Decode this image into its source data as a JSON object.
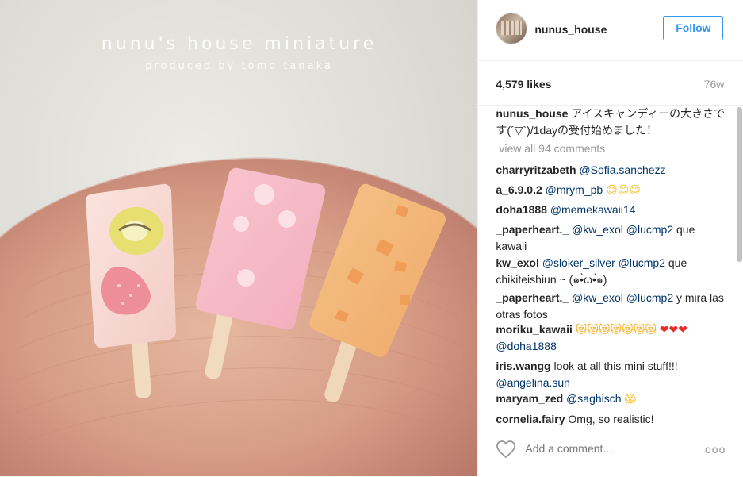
{
  "photo": {
    "watermark_title": "nunu's house miniature",
    "watermark_sub": "produced by tomo tanaka"
  },
  "post": {
    "username": "nunus_house",
    "follow_label": "Follow",
    "likes": "4,579 likes",
    "age": "76w",
    "caption_user": "nunus_house",
    "caption_text": "アイスキャンディーの大きさです(´▽`)/1dayの受付始めました！",
    "view_all": "view all 94 comments",
    "add_comment_placeholder": "Add a comment...",
    "more_label": "ooo"
  },
  "comments": [
    {
      "user": "charryritzabeth",
      "parts": [
        {
          "t": "mention",
          "v": "@Sofia.sanchezz"
        }
      ]
    },
    {
      "user": "a_6.9.0.2",
      "parts": [
        {
          "t": "mention",
          "v": "@mrym_pb"
        },
        {
          "t": "text",
          "v": " "
        },
        {
          "t": "emoji",
          "v": "😊😊😊",
          "cls": "yface"
        }
      ]
    },
    {
      "user": "doha1888",
      "parts": [
        {
          "t": "mention",
          "v": "@memekawaii14"
        }
      ]
    },
    {
      "user": "_paperheart._",
      "parts": [
        {
          "t": "mention",
          "v": "@kw_exol"
        },
        {
          "t": "text",
          "v": " "
        },
        {
          "t": "mention",
          "v": "@lucmp2"
        },
        {
          "t": "text",
          "v": " que kawaii"
        }
      ]
    },
    {
      "user": "kw_exol",
      "parts": [
        {
          "t": "mention",
          "v": "@sloker_silver"
        },
        {
          "t": "text",
          "v": " "
        },
        {
          "t": "mention",
          "v": "@lucmp2"
        },
        {
          "t": "text",
          "v": " que chikiteishiun ~ (๑•̀ω•́๑)"
        }
      ]
    },
    {
      "user": "_paperheart._",
      "parts": [
        {
          "t": "mention",
          "v": "@kw_exol"
        },
        {
          "t": "text",
          "v": " "
        },
        {
          "t": "mention",
          "v": "@lucmp2"
        },
        {
          "t": "text",
          "v": " y mira las otras fotos"
        }
      ]
    },
    {
      "user": "moriku_kawaii",
      "parts": [
        {
          "t": "emoji",
          "v": "😻😻😻😻😻😻😻",
          "cls": "cat"
        },
        {
          "t": "text",
          "v": " "
        },
        {
          "t": "emoji",
          "v": "❤❤❤",
          "cls": "heart"
        },
        {
          "t": "text",
          "v": " "
        },
        {
          "t": "mention",
          "v": "@doha1888"
        }
      ]
    },
    {
      "user": "iris.wangg",
      "parts": [
        {
          "t": "text",
          "v": "look at all this mini stuff!!! "
        },
        {
          "t": "mention",
          "v": "@angelina.sun"
        }
      ]
    },
    {
      "user": "maryam_zed",
      "parts": [
        {
          "t": "mention",
          "v": "@saghisch"
        },
        {
          "t": "text",
          "v": " "
        },
        {
          "t": "emoji",
          "v": "😱",
          "cls": "yface"
        }
      ]
    },
    {
      "user": "cornelia.fairy",
      "parts": [
        {
          "t": "text",
          "v": "Omg, so realistic!"
        }
      ]
    }
  ]
}
